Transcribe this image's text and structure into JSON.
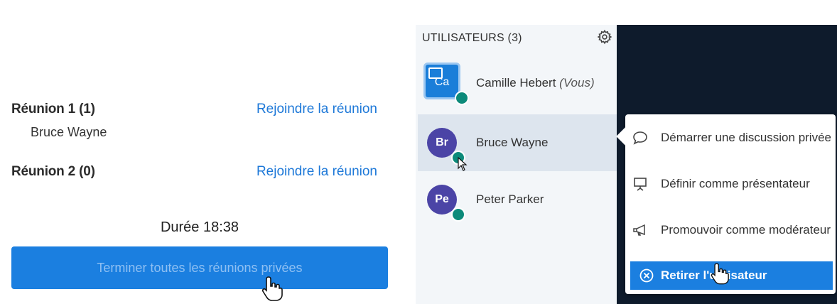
{
  "breakout": {
    "rooms": [
      {
        "name": "Réunion 1 (1)",
        "join_label": "Rejoindre la réunion",
        "members": [
          "Bruce Wayne"
        ]
      },
      {
        "name": "Réunion 2 (0)",
        "join_label": "Rejoindre la réunion",
        "members": []
      }
    ],
    "duration_label": "Durée 18:38",
    "end_all_label": "Terminer toutes les réunions privées"
  },
  "users": {
    "header": "UTILISATEURS (3)",
    "list": [
      {
        "initials": "Ca",
        "name": "Camille Hebert",
        "suffix": "(Vous)",
        "is_presenter": true
      },
      {
        "initials": "Br",
        "name": "Bruce Wayne",
        "selected": true
      },
      {
        "initials": "Pe",
        "name": "Peter Parker"
      }
    ]
  },
  "context_menu": {
    "items": [
      {
        "label": "Démarrer une discussion privée",
        "icon": "chat-bubble-icon"
      },
      {
        "label": "Définir comme présentateur",
        "icon": "presentation-icon"
      },
      {
        "label": "Promouvoir comme modérateur",
        "icon": "megaphone-icon"
      },
      {
        "label": "Retirer l'utilisateur",
        "icon": "remove-circle-icon",
        "active": true
      }
    ]
  },
  "colors": {
    "accent": "#1b7fe0",
    "link": "#1d78d8",
    "avatar": "#4b44a6",
    "status": "#0c8a7a",
    "dark_bg": "#0e1b2c",
    "panel_bg": "#f3f6f9"
  }
}
